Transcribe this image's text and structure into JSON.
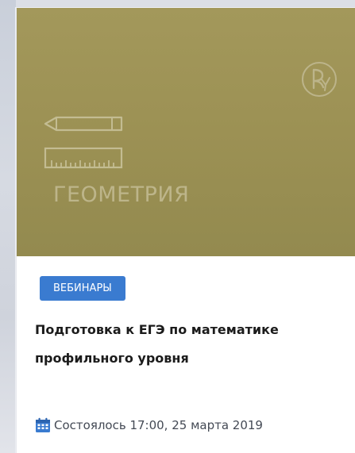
{
  "cover": {
    "subject": "ГЕОМЕТРИЯ",
    "background_color": "#9c9154",
    "icons": [
      "pencil-icon",
      "ruler-icon",
      "brand-logo-icon"
    ]
  },
  "badge": {
    "label": "ВЕБИНАРЫ",
    "color": "#3a7bd0"
  },
  "card": {
    "title": "Подготовка к ЕГЭ по математике профильного уровня",
    "status_text": "Состоялось 17:00, 25 марта 2019",
    "status_icon": "calendar-icon"
  }
}
